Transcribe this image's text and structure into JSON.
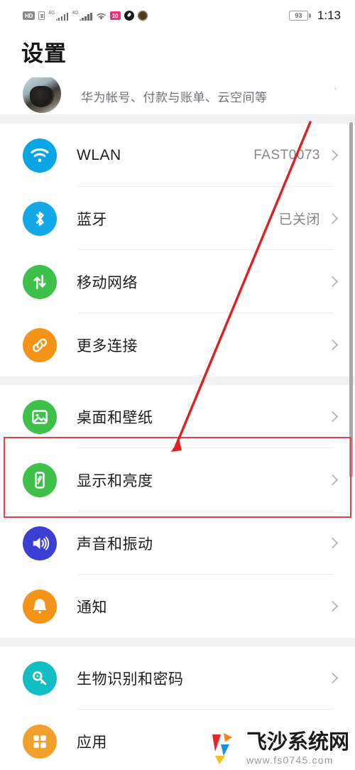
{
  "status_bar": {
    "hd_label": "HD",
    "sim_icon": "sim-card-icon",
    "signal1_label": "4G",
    "signal2_label": "4G",
    "wifi_icon": "wifi-icon",
    "pink_badge_label": "10",
    "drop_icon": "water-drop-icon",
    "dark_icon": "app-badge-icon",
    "battery_level": "93",
    "time": "1:13"
  },
  "header": {
    "title": "设置"
  },
  "account": {
    "subtitle": "华为帐号、付款与账单、云空间等",
    "avatar_name": "user-avatar"
  },
  "sections": [
    {
      "rows": [
        {
          "icon": "wifi-icon",
          "icon_color": "#0aa5e4",
          "label": "WLAN",
          "value": "FAST0073"
        },
        {
          "icon": "bluetooth-icon",
          "icon_color": "#13a8e8",
          "label": "蓝牙",
          "value": "已关闭"
        },
        {
          "icon": "mobile-network-icon",
          "icon_color": "#3ec04b",
          "label": "移动网络",
          "value": ""
        },
        {
          "icon": "link-icon",
          "icon_color": "#f49316",
          "label": "更多连接",
          "value": ""
        }
      ]
    },
    {
      "rows": [
        {
          "icon": "wallpaper-icon",
          "icon_color": "#3ec04b",
          "label": "桌面和壁纸",
          "value": ""
        },
        {
          "icon": "display-brightness-icon",
          "icon_color": "#3ec04b",
          "label": "显示和亮度",
          "value": ""
        },
        {
          "icon": "sound-vibration-icon",
          "icon_color": "#3b3fd4",
          "label": "声音和振动",
          "value": ""
        },
        {
          "icon": "bell-icon",
          "icon_color": "#f49316",
          "label": "通知",
          "value": ""
        }
      ]
    },
    {
      "rows": [
        {
          "icon": "key-icon",
          "icon_color": "#12bdc4",
          "label": "生物识别和密码",
          "value": ""
        },
        {
          "icon": "apps-grid-icon",
          "icon_color": "#f2a02b",
          "label": "应用",
          "value": ""
        }
      ]
    }
  ],
  "annotation": {
    "highlight_color": "#e8414b",
    "arrow_color": "#e02020",
    "highlighted_row_label": "显示和亮度"
  },
  "watermark": {
    "site_name": "飞沙系统网",
    "url": "www.fs0745.com"
  }
}
